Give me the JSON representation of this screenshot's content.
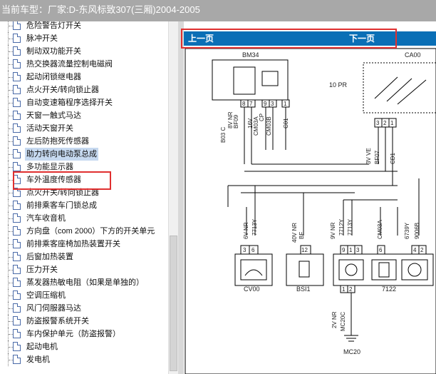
{
  "window": {
    "title": "当前车型：厂家:D-东风标致307(三厢)2004-2005"
  },
  "tree": {
    "items": [
      "危险警告灯开关",
      "脉冲开关",
      "制动双功能开关",
      "热交换器流量控制电磁阀",
      "起动闭锁继电器",
      "点火开关/转向锁止器",
      "自动变速箱程序选择开关",
      "天窗一触式马达",
      "活动天窗开关",
      "左后防抱死传感器",
      "助力转向电动泵总成",
      "多功能显示器",
      "车外温度传感器",
      "点火开关/转向锁止器",
      "前排乘客车门锁总成",
      "汽车收音机",
      "方向盘（com 2000）下方的开关单元",
      "前排乘客座椅加热装置开关",
      "后窗加热装置",
      "压力开关",
      "蒸发器热敏电阻（如果是单独的）",
      "空调压缩机",
      "风门伺服器马达",
      "防盗报警系统开关",
      "车内保护单元（防盗报警）",
      "起动电机",
      "发电机"
    ],
    "selected_index": 10
  },
  "nav": {
    "prev_label": "上一页",
    "next_label": "下一页"
  },
  "diagram": {
    "labels": {
      "bm34": "BM34",
      "ca00": "CA00",
      "ten_pr": "10 PR",
      "b03": "B03 C",
      "v8nr": "8V NR",
      "bf09": "BF09",
      "v16": "16V",
      "cm03a": "CM03A",
      "cp": "CP",
      "cm03b": "CM03B",
      "c01": "C01",
      "v3ve": "3V VE",
      "bf07": "BF07",
      "cd1": "CD1",
      "v6nr": "6V NR",
      "w7713y": "7713Y",
      "w7712y": "7712Y",
      "v40nr": "40V NR",
      "v9nr": "9V NR",
      "bf": "BF",
      "w7713y_b": "7713Y",
      "cm03a_b": "CM03A",
      "w6739y": "6739Y",
      "w9006b": "9006B",
      "cv00": "CV00",
      "bsi1": "BSI1",
      "c7122": "7122",
      "v2nr": "2V NR",
      "mc20c": "MC20C",
      "mc20": "MC20",
      "p8": "8",
      "p7": "7",
      "p9": "9",
      "p3": "3",
      "p1": "1",
      "p6": "6",
      "p12": "12",
      "p9b": "9",
      "p1b": "1",
      "p3b": "3",
      "p6b": "6",
      "p4": "4",
      "p2": "2",
      "ap1": "1",
      "ap2": "2"
    }
  }
}
